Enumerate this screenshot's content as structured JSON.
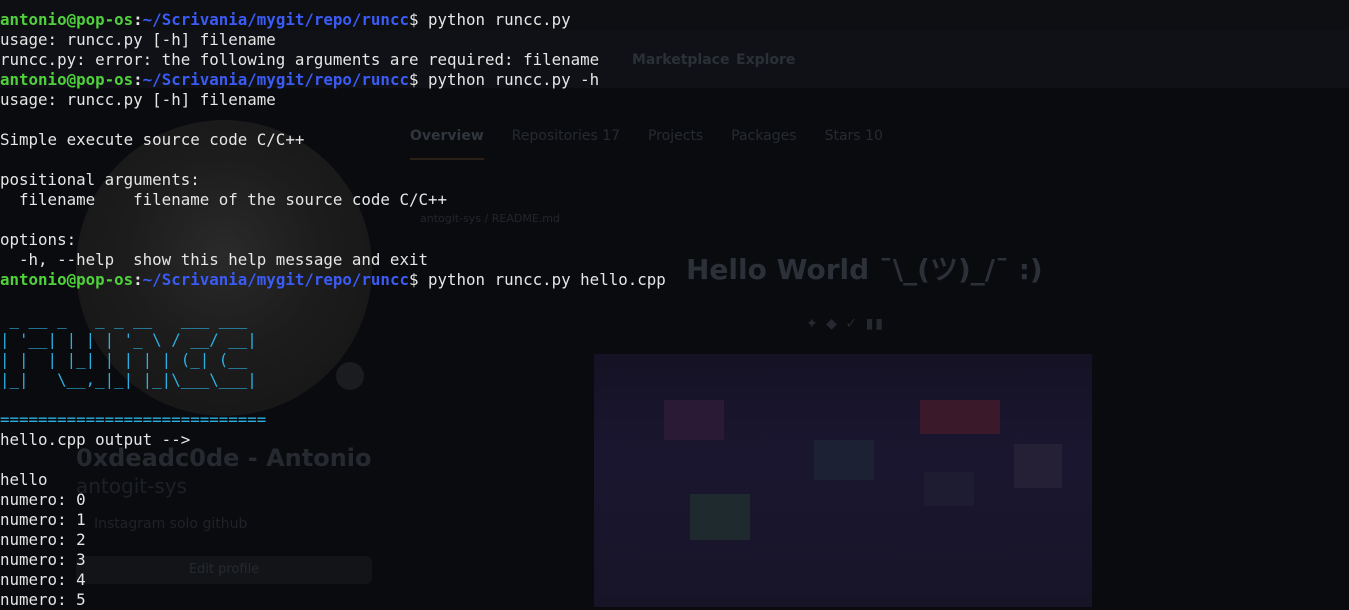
{
  "prompt": {
    "user": "antonio@pop-os",
    "path": "~/Scrivania/mygit/repo/runcc",
    "symbol": "$"
  },
  "commands": [
    "python runcc.py",
    "python runcc.py -h",
    "python runcc.py hello.cpp"
  ],
  "output": {
    "usage1": "usage: runcc.py [-h] filename",
    "error": "runcc.py: error: the following arguments are required: filename",
    "usage2": "usage: runcc.py [-h] filename",
    "description": "Simple execute source code C/C++",
    "positional_header": "positional arguments:",
    "positional_filename": "  filename    filename of the source code C/C++",
    "options_header": "options:",
    "options_help": "  -h, --help  show this help message and exit"
  },
  "banner": {
    "art": [
      " _ __ _   _ _ __   ___ ___",
      "| '__| | | | '_ \\ / __/ __|",
      "| |  | |_| | | | | (_| (__",
      "|_|   \\__,_|_| |_|\\___\\___|"
    ],
    "separator": "============================"
  },
  "program_output": {
    "header": "hello.cpp output -->",
    "lines": [
      "hello",
      "numero: 0",
      "numero: 1",
      "numero: 2",
      "numero: 3",
      "numero: 4",
      "numero: 5"
    ]
  },
  "background": {
    "nav": [
      "Marketplace",
      "Explore"
    ],
    "tabs": [
      {
        "label": "Overview",
        "count": ""
      },
      {
        "label": "Repositories",
        "count": "17"
      },
      {
        "label": "Projects",
        "count": ""
      },
      {
        "label": "Packages",
        "count": ""
      },
      {
        "label": "Stars",
        "count": "10"
      }
    ],
    "profile_name": "0xdeadc0de - Antonio",
    "profile_login": "antogit-sys",
    "profile_bio": "Instagram solo github",
    "edit_profile": "Edit profile",
    "readme_crumb": "antogit-sys / README.md",
    "readme_title": "Hello World ¯\\_(ツ)_/¯ :)"
  },
  "colors": {
    "user": "#4fd13b",
    "path": "#3b5bf5",
    "banner": "#2ab0e0",
    "text": "#e6e6e6",
    "background": "#0a0b0e"
  }
}
